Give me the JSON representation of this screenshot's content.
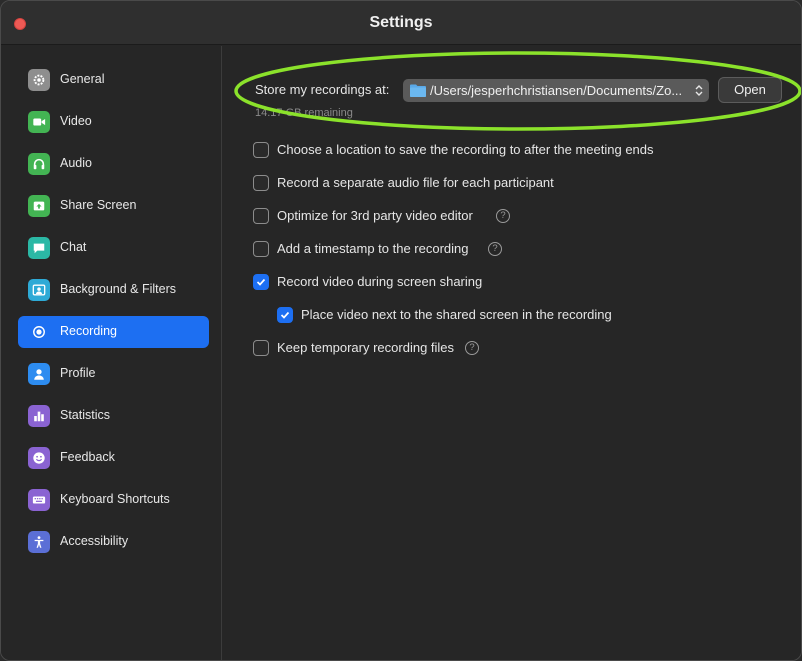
{
  "window": {
    "title": "Settings"
  },
  "sidebar": {
    "items": [
      {
        "label": "General",
        "icon": "gear-icon",
        "color": "#8e8e8e",
        "active": false
      },
      {
        "label": "Video",
        "icon": "video-camera-icon",
        "color": "#43b453",
        "active": false
      },
      {
        "label": "Audio",
        "icon": "headphones-icon",
        "color": "#43b453",
        "active": false
      },
      {
        "label": "Share Screen",
        "icon": "share-screen-icon",
        "color": "#43b453",
        "active": false
      },
      {
        "label": "Chat",
        "icon": "chat-bubble-icon",
        "color": "#2bb8a5",
        "active": false
      },
      {
        "label": "Background & Filters",
        "icon": "portrait-background-icon",
        "color": "#2eaad6",
        "active": false
      },
      {
        "label": "Recording",
        "icon": "record-circle-icon",
        "color": "#1d6ff2",
        "active": true
      },
      {
        "label": "Profile",
        "icon": "person-icon",
        "color": "#2d8cf0",
        "active": false
      },
      {
        "label": "Statistics",
        "icon": "bar-chart-icon",
        "color": "#8a63d2",
        "active": false
      },
      {
        "label": "Feedback",
        "icon": "smiley-icon",
        "color": "#8a63d2",
        "active": false
      },
      {
        "label": "Keyboard Shortcuts",
        "icon": "keyboard-icon",
        "color": "#8a63d2",
        "active": false
      },
      {
        "label": "Accessibility",
        "icon": "accessibility-person-icon",
        "color": "#5b6fd6",
        "active": false
      }
    ]
  },
  "recording": {
    "store_label": "Store my recordings at:",
    "path": "/Users/jesperhchristiansen/Documents/Zo...",
    "open_label": "Open",
    "remaining": "14.17 GB remaining",
    "options": [
      {
        "label": "Choose a location to save the recording to after the meeting ends",
        "checked": false,
        "help": false,
        "indent": false
      },
      {
        "label": "Record a separate audio file for each participant",
        "checked": false,
        "help": false,
        "indent": false
      },
      {
        "label": "Optimize for 3rd party video editor",
        "checked": false,
        "help": true,
        "indent": false
      },
      {
        "label": "Add a timestamp to the recording",
        "checked": false,
        "help": true,
        "indent": false
      },
      {
        "label": "Record video during screen sharing",
        "checked": true,
        "help": false,
        "indent": false
      },
      {
        "label": "Place video next to the shared screen in the recording",
        "checked": true,
        "help": false,
        "indent": true
      },
      {
        "label": "Keep temporary recording files",
        "checked": false,
        "help": true,
        "indent": false
      }
    ],
    "help_glyph": "?"
  },
  "colors": {
    "accent": "#1d6ff2",
    "highlight_ellipse": "#8be22b",
    "close_button": "#ee5a55"
  }
}
